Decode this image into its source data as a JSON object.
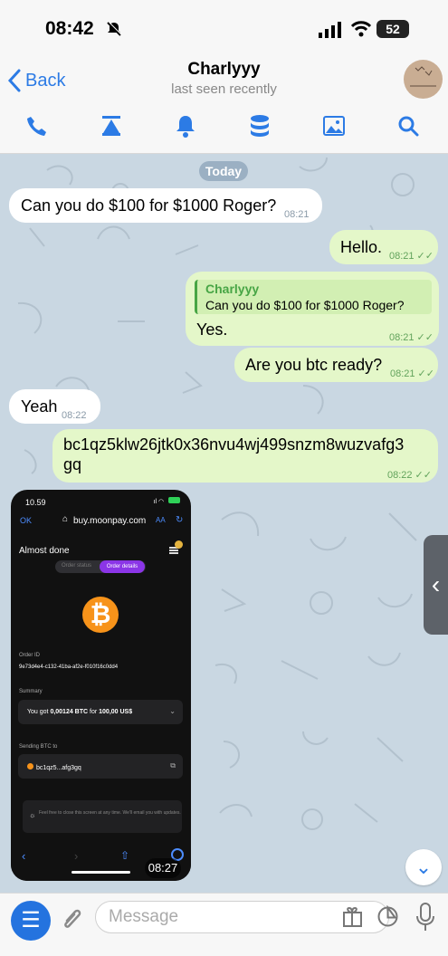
{
  "status_bar": {
    "time": "08:42",
    "battery": "52"
  },
  "header": {
    "back_label": "Back",
    "title": "Charlyyy",
    "subtitle": "last seen recently",
    "icons": [
      "phone-icon",
      "pin-icon",
      "bell-icon",
      "database-icon",
      "image-icon",
      "search-icon"
    ]
  },
  "chat": {
    "date_label": "Today",
    "messages": [
      {
        "direction": "incoming",
        "text": "Can you do $100 for $1000 Roger?",
        "time": "08:21"
      },
      {
        "direction": "outgoing",
        "text": "Hello.",
        "time": "08:21",
        "ticks": "✓✓"
      },
      {
        "direction": "outgoing",
        "reply_name": "Charlyyy",
        "reply_text": "Can you do $100 for $1000 Roger?",
        "text": "Yes.",
        "time": "08:21",
        "ticks": "✓✓"
      },
      {
        "direction": "outgoing",
        "text": "Are you btc ready?",
        "time": "08:21",
        "ticks": "✓✓"
      },
      {
        "direction": "incoming",
        "text": "Yeah",
        "time": "08:22"
      },
      {
        "direction": "outgoing",
        "text_line1": "bc1qz5klw26jtk0x36nvu4wj499snzm8wuzvafg3",
        "text_line2": "gq",
        "time": "08:22",
        "ticks": "✓✓"
      }
    ],
    "screenshot": {
      "time": "10.59",
      "ok": "OK",
      "url": "buy.moonpay.com",
      "aa": "AA",
      "title": "Almost done",
      "tab_status": "Order status",
      "tab_details": "Order details",
      "order_label": "Order ID",
      "order_id": "9e73d4e4-c132-41ba-af2e-f010f16c0dd4",
      "summary_label": "Summary",
      "summary_prefix": "You got ",
      "summary_amount": "0,00124 BTC",
      "summary_mid": " for ",
      "summary_price": "100,00 US$",
      "sending_label": "Sending BTC to",
      "address": "bc1qz5...afg3gq",
      "info": "Feel free to close this screen at any time. We'll email you with updates.",
      "media_time": "08:27"
    }
  },
  "input_bar": {
    "placeholder": "Message"
  },
  "colors": {
    "accent": "#2c7be5",
    "outgoing_bubble": "#e4f7c9",
    "incoming_bubble": "#ffffff",
    "chat_background": "#c9d7e2"
  }
}
